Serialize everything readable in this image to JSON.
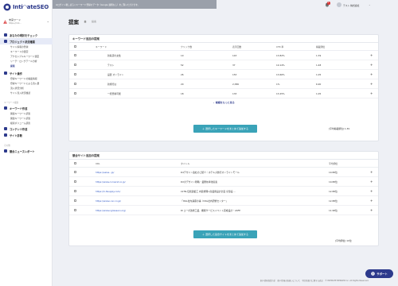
{
  "app": {
    "logo_text": "Inti◠ateSEO"
  },
  "project": {
    "name": "未来ワード",
    "url": "https://inti...",
    "caret": "⌄"
  },
  "sidebar": {
    "collapse": "«",
    "top_items": [
      {
        "label": "あなたの現状をチェック"
      },
      {
        "label": "プロジェクト状況確認"
      }
    ],
    "project_sub": [
      "サイト情報の登録",
      "キーワードの選定",
      "アクセシブルキーワード選定",
      "リーチ・ロングテール分析",
      "提案"
    ],
    "site_item": {
      "label": "サイト操作"
    },
    "site_sub": [
      "登録キーワードの掲載情報",
      "登録キーワードによる流入量",
      "流入状況分析",
      "サイト流入状況確認"
    ],
    "section_keywords": "キーワード検索",
    "keyword_item": {
      "label": "キーワード作成"
    },
    "keyword_sub": [
      "関連キーワード調査",
      "関連キーワード調査",
      "検索ボリューム調査"
    ],
    "content_item": {
      "label": "コンテンツ作成"
    },
    "site_diag_item": {
      "label": "サイト診断"
    },
    "section_other": "その他",
    "report_item": {
      "label": "競合ニュースレポート"
    }
  },
  "topbar": {
    "banner": "※ログイン後しばらくキーワード登録のデータ（Google 連携なし）をご覧いただけます。",
    "bell_count": "1",
    "user_name": "テスト 株式会社",
    "user_caret": "⌄"
  },
  "page": {
    "title": "提案",
    "breadcrumb": "提案"
  },
  "keyword_card": {
    "title": "キーワード追加の提案",
    "headers": [
      "キーワード",
      "クリック数",
      "表示回数",
      "CTR 率",
      "掲載順位"
    ],
    "rows": [
      {
        "keyword": "新着店の女性",
        "clicks": "10",
        "impressions": "143",
        "ctr": "13.82%",
        "rank": "1.39"
      },
      {
        "keyword": "テスト",
        "clicks": "52",
        "impressions": "37",
        "ctr": "10.14%",
        "rank": "1.48"
      },
      {
        "keyword": "設置 オンライン",
        "clicks": "26",
        "impressions": "153",
        "ctr": "13.66%",
        "rank": "1.05"
      },
      {
        "keyword": "新規行は",
        "clicks": "20",
        "impressions": "2,386",
        "ctr": "1%",
        "rank": "6.90"
      },
      {
        "keyword": "一括登録可能",
        "clicks": "18",
        "impressions": "133",
        "ctr": "13.25%",
        "rank": "1.05"
      }
    ],
    "more_label": "候補をもっと見る",
    "button_label": "＋ 選択したキーワードをまとめて追加する",
    "count_label": "[平均掲載順位] 1.39"
  },
  "competitor_card": {
    "title": "競合サイト追加の提案",
    "headers": [
      "URL",
      "タイトル",
      "平均順位"
    ],
    "rows": [
      {
        "url": "https://sales...jp/",
        "title": "D4デザイン会社のご紹介｜ホテルズ旅行オンラインモール",
        "rank": "10.88位"
      },
      {
        "url": "https://www.cornerst.co.jp/",
        "title": "DXのデザイン戦略・業務効率化提案",
        "rank": "10.88位"
      },
      {
        "url": "https://h-ltsupply.com/",
        "title": "LSTN-伝統建築工 内装修理×商業用設計企画 全部設 ...",
        "rank": "12.88位"
      },
      {
        "url": "https://www.i-rec.co.jp/",
        "title": "「ISSL社内講座の事（ISSL社内研修センター」",
        "rank": "12.88位"
      },
      {
        "url": "https://www.ngliesserv.org/",
        "title": "RI コーポ改修工業、機能サービスイベント完成設計・ASFE",
        "rank": "11.98位"
      }
    ],
    "button_label": "＋ 選択した競合サイトをまとめて追加する",
    "count_label": "[平均順位] 10位"
  },
  "footer": {
    "text": "個人情報保護方針　個人情報の取扱いについて　特定商取引に関する表記　© INTIMATE MERGER Inc. All Rights Reserved."
  },
  "support": {
    "label": "サポート"
  }
}
